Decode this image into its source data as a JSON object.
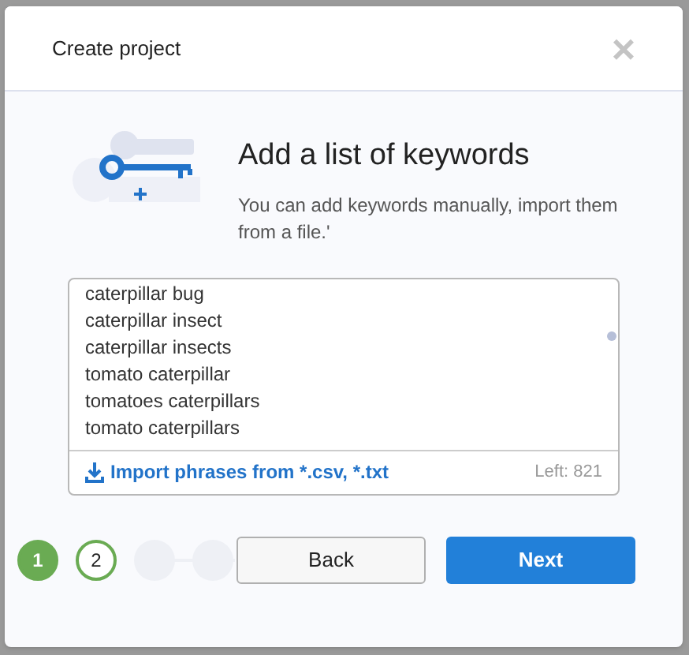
{
  "window": {
    "title": "Create project",
    "close": "×"
  },
  "intro": {
    "heading": "Add a list of keywords",
    "description": "You can add keywords manually, import them from a file.'"
  },
  "keywords": [
    "caterpillar bug",
    "caterpillar insect",
    "caterpillar insects",
    "tomato caterpillar",
    "tomatoes caterpillars",
    "tomato caterpillars"
  ],
  "import_link": "Import phrases from *.csv, *.txt",
  "remaining": "Left: 821",
  "steps": [
    {
      "label": "1",
      "done": true,
      "selected": false
    },
    {
      "label": "2",
      "done": false,
      "selected": true
    },
    {
      "done": false,
      "selected": false
    },
    {
      "done": false,
      "selected": false
    }
  ],
  "buttons": [
    {
      "label": "Back",
      "kind": "secondary"
    },
    {
      "label": "Next",
      "kind": "primary"
    }
  ]
}
